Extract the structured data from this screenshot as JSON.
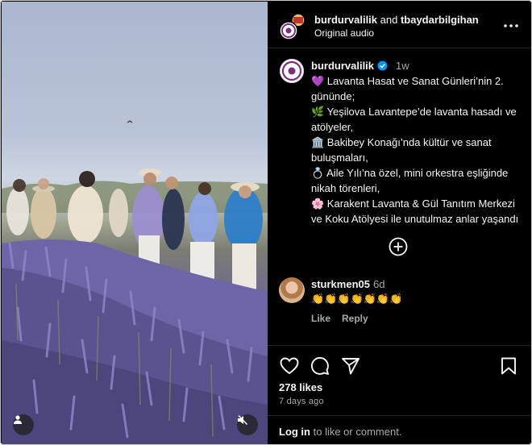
{
  "header": {
    "author_primary": "burdurvalilik",
    "joiner": " and ",
    "author_secondary": "tbaydarbilgihan",
    "audio": "Original audio",
    "more_icon": "more-horizontal-icon"
  },
  "caption": {
    "username": "burdurvalilik",
    "verified": true,
    "time": "1w",
    "lines": [
      "💜 Lavanta Hasat ve Sanat Günleri’nin 2. gününde;",
      "🌿 Yeşilova Lavantepe’de lavanta hasadı ve atölyeler,",
      "🏛️ Bakibey Konağı’nda kültür ve sanat buluşmaları,",
      "💍 Aile Yılı’na özel, mini orkestra eşliğinde nikah törenleri,",
      "🌸 Karakent Lavanta & Gül Tanıtım Merkezi ve Koku Atölyesi ile unutulmaz anlar yaşandı"
    ]
  },
  "comment": {
    "username": "sturkmen05",
    "time": "6d",
    "text": "👏👏👏👏👏👏👏",
    "like_label": "Like",
    "reply_label": "Reply"
  },
  "footer": {
    "likes": "278 likes",
    "posted": "7 days ago",
    "login_link": "Log in",
    "login_rest": " to like or comment."
  },
  "colors": {
    "background": "#000000",
    "text": "#f5f5f5",
    "muted": "#a8a8a8",
    "verified": "#0095f6",
    "divider": "#262626"
  }
}
